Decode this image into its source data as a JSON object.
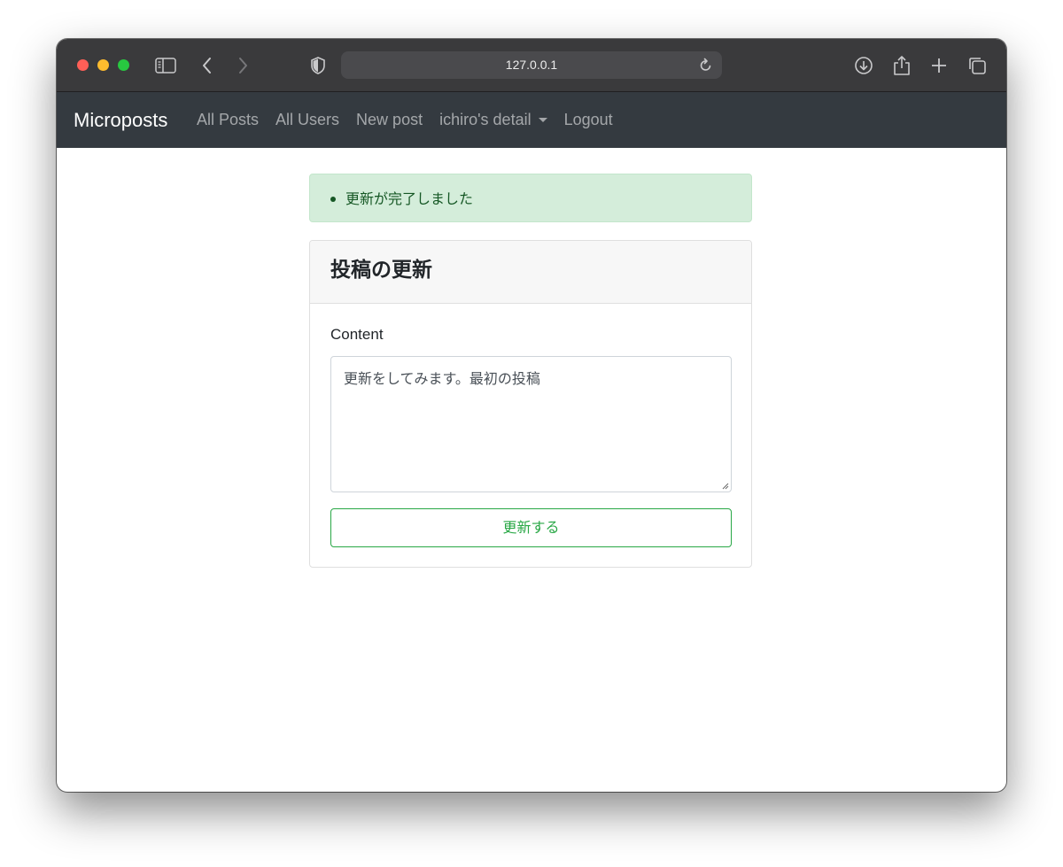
{
  "browser": {
    "url": "127.0.0.1",
    "icons": [
      "sidebar-icon",
      "back-icon",
      "forward-icon",
      "shield-icon",
      "reload-icon",
      "download-icon",
      "share-icon",
      "new-tab-icon",
      "tabs-overview-icon"
    ]
  },
  "navbar": {
    "brand": "Microposts",
    "links": [
      "All Posts",
      "All Users",
      "New post",
      "ichiro's detail",
      "Logout"
    ],
    "bg_color": "#343a40"
  },
  "alert": {
    "messages": [
      "更新が完了しました"
    ],
    "color": "#d4edda"
  },
  "card": {
    "title": "投稿の更新",
    "field_label": "Content",
    "content_value": "更新をしてみます。最初の投稿",
    "submit_label": "更新する",
    "accent": "#28a745"
  }
}
